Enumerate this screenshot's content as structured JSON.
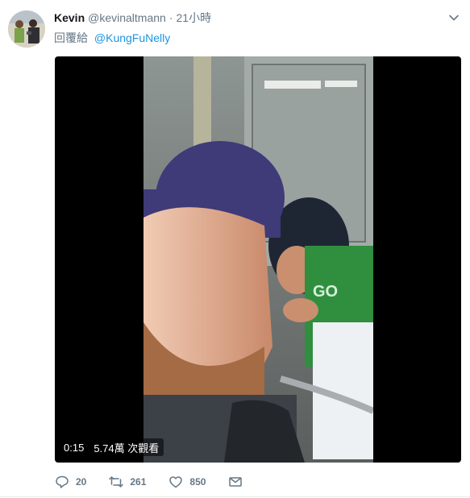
{
  "tweet": {
    "display_name": "Kevin",
    "handle": "@kevinaltmann",
    "separator": "·",
    "time": "21小時",
    "reply_prefix": "回覆給",
    "reply_to": "@KungFuNelly",
    "video": {
      "duration": "0:15",
      "views": "5.74萬 次觀看"
    },
    "actions": {
      "replies": "20",
      "retweets": "261",
      "likes": "850"
    },
    "accent_color": "#1b95e0",
    "icons": [
      "caret-down-icon",
      "reply-icon",
      "retweet-icon",
      "heart-icon",
      "message-icon"
    ]
  }
}
